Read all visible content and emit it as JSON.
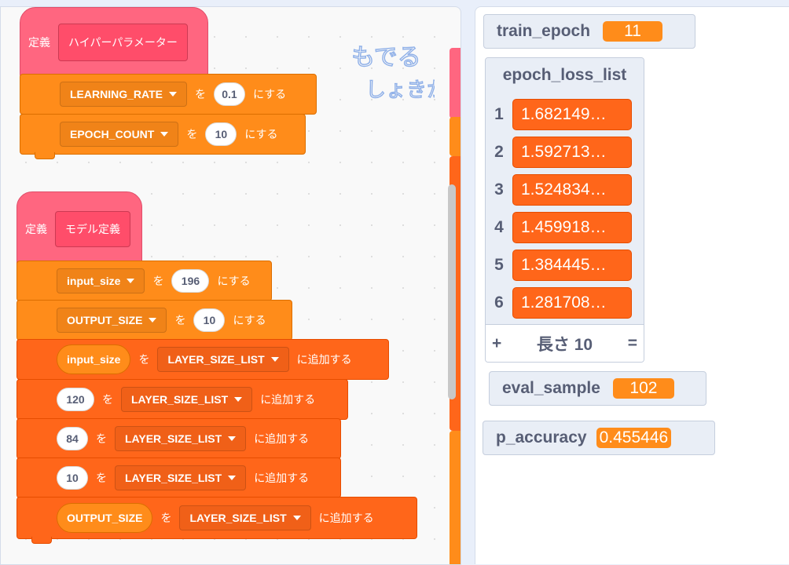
{
  "code": {
    "define1": {
      "keyword": "定義",
      "name": "ハイパーパラメーター"
    },
    "set_lr": {
      "var": "LEARNING_RATE",
      "to": "を",
      "value": "0.1",
      "suffix": "にする"
    },
    "set_epoch": {
      "var": "EPOCH_COUNT",
      "to": "を",
      "value": "10",
      "suffix": "にする"
    },
    "define2": {
      "keyword": "定義",
      "name": "モデル定義"
    },
    "set_input": {
      "var": "input_size",
      "to": "を",
      "value": "196",
      "suffix": "にする"
    },
    "set_output": {
      "var": "OUTPUT_SIZE",
      "to": "を",
      "value": "10",
      "suffix": "にする"
    },
    "add1": {
      "item": "input_size",
      "to": "を",
      "list": "LAYER_SIZE_LIST",
      "suffix": "に追加する"
    },
    "add2": {
      "item": "120",
      "to": "を",
      "list": "LAYER_SIZE_LIST",
      "suffix": "に追加する"
    },
    "add3": {
      "item": "84",
      "to": "を",
      "list": "LAYER_SIZE_LIST",
      "suffix": "に追加する"
    },
    "add4": {
      "item": "10",
      "to": "を",
      "list": "LAYER_SIZE_LIST",
      "suffix": "に追加する"
    },
    "add5": {
      "item": "OUTPUT_SIZE",
      "to": "を",
      "list": "LAYER_SIZE_LIST",
      "suffix": "に追加する"
    }
  },
  "handwriting": {
    "line1": "もでる",
    "line2": "しょきか"
  },
  "monitors": {
    "train_epoch": {
      "label": "train_epoch",
      "value": "11"
    },
    "eval_sample": {
      "label": "eval_sample",
      "value": "102"
    },
    "p_accuracy": {
      "label": "p_accuracy",
      "value": "0.455446"
    }
  },
  "list": {
    "title": "epoch_loss_list",
    "items": [
      {
        "index": "1",
        "value": "1.682149…"
      },
      {
        "index": "2",
        "value": "1.592713…"
      },
      {
        "index": "3",
        "value": "1.524834…"
      },
      {
        "index": "4",
        "value": "1.459918…"
      },
      {
        "index": "5",
        "value": "1.384445…"
      },
      {
        "index": "6",
        "value": "1.281708…"
      }
    ],
    "add": "+",
    "length": "長さ 10",
    "resize": "="
  },
  "colors": {
    "define": "#ff6680",
    "variables": "#ff8c1a",
    "lists": "#ff661a",
    "monitor_bg": "#e9eef6",
    "text": "#575e75"
  }
}
